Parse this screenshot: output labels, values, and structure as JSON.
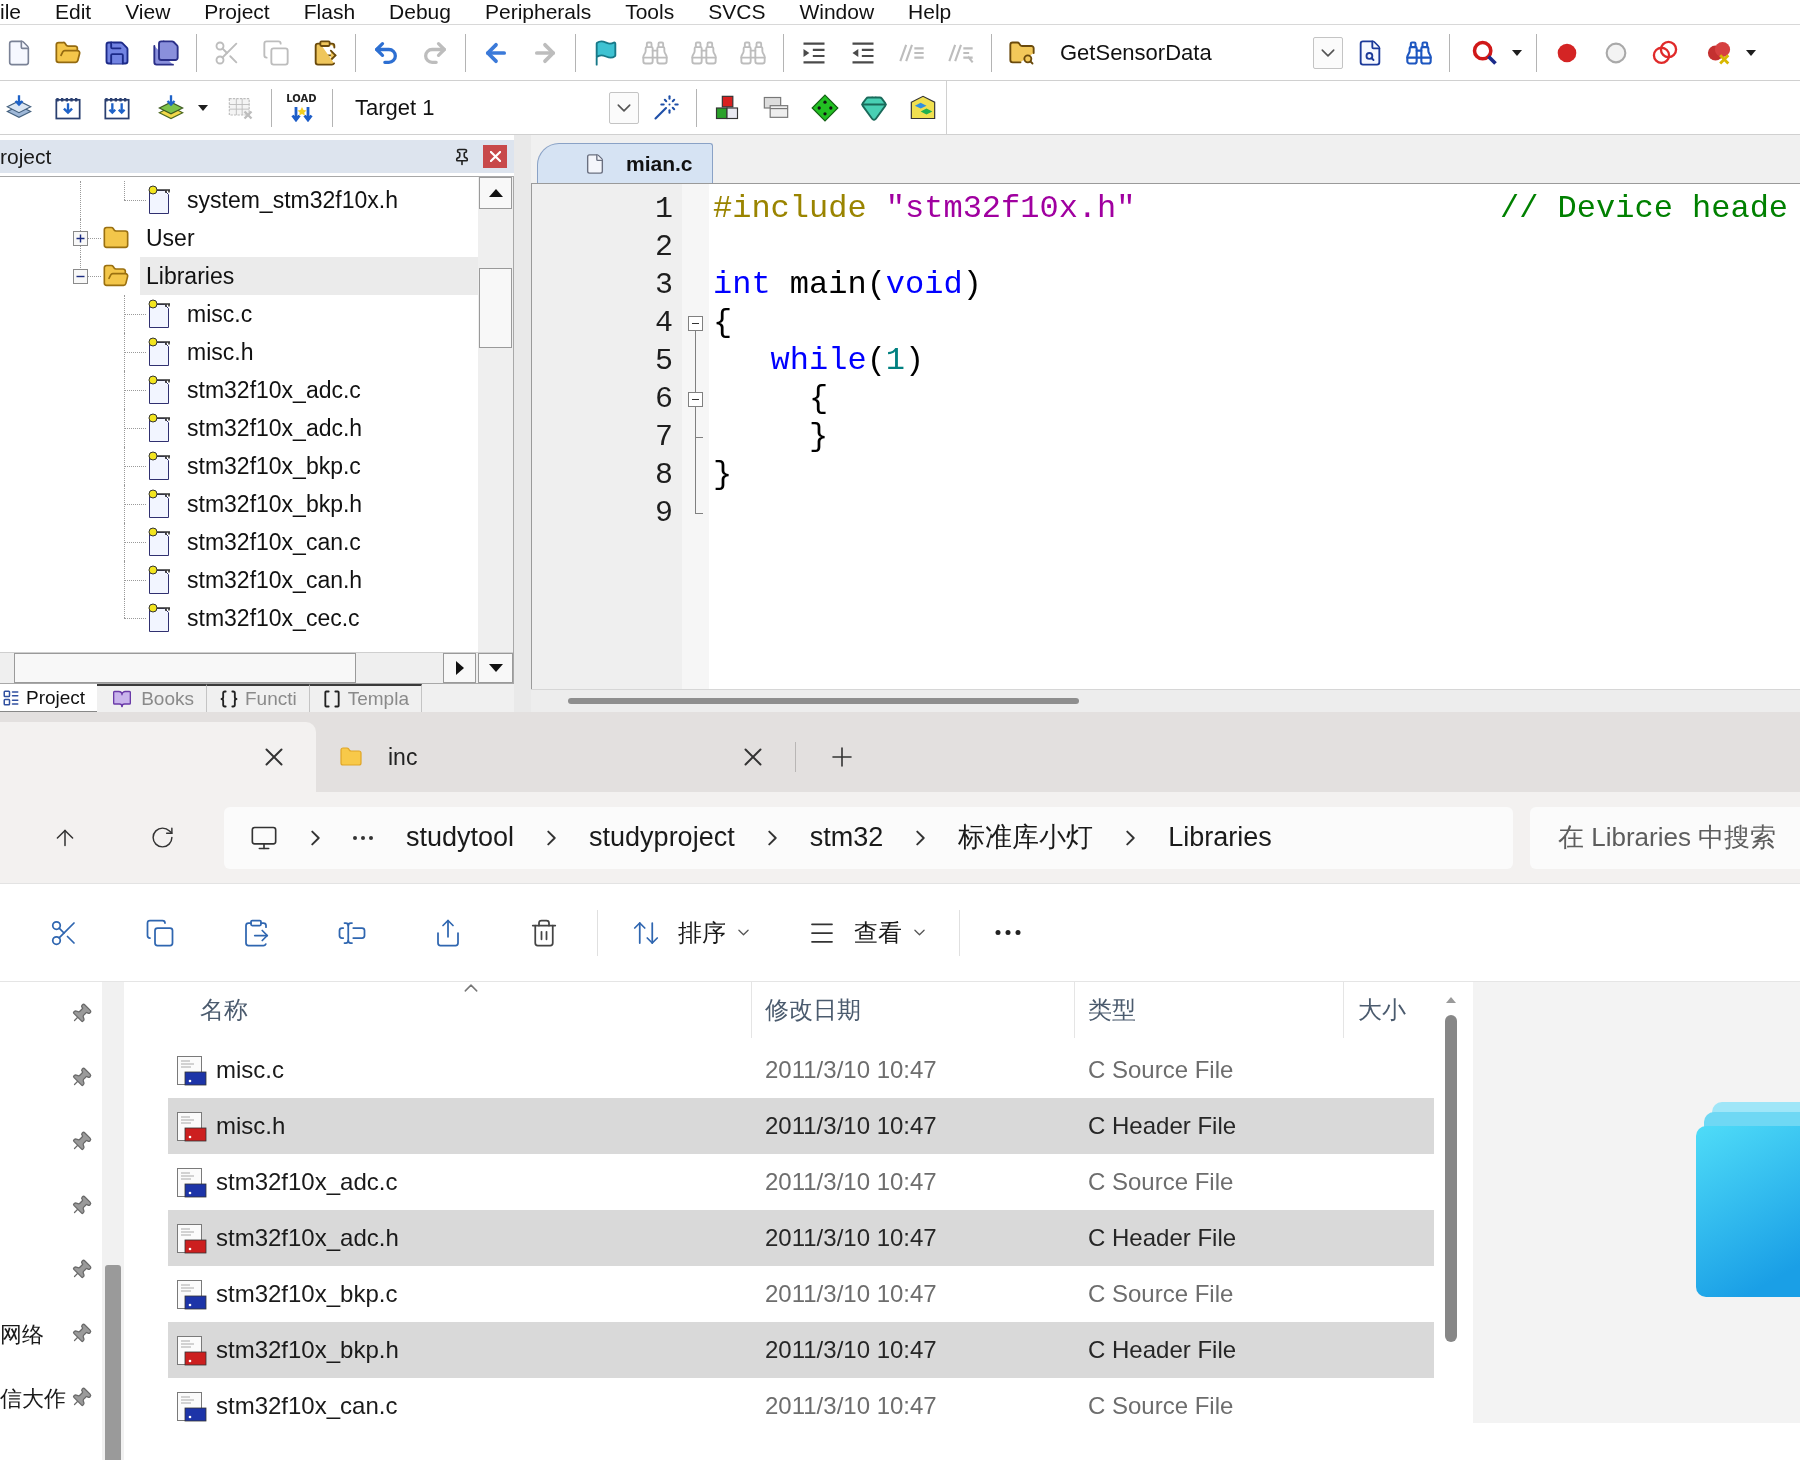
{
  "ide": {
    "menu": [
      "ile",
      "Edit",
      "View",
      "Project",
      "Flash",
      "Debug",
      "Peripherals",
      "Tools",
      "SVCS",
      "Window",
      "Help"
    ],
    "toolbar_1": [
      {
        "kind": "button",
        "disabled": false
      },
      {
        "kind": "button",
        "disabled": false
      },
      {
        "kind": "button",
        "disabled": false
      },
      {
        "kind": "button",
        "disabled": false
      },
      {
        "kind": "separator"
      },
      {
        "kind": "button",
        "disabled": true
      },
      {
        "kind": "button",
        "disabled": true
      },
      {
        "kind": "button",
        "disabled": false
      },
      {
        "kind": "separator"
      },
      {
        "kind": "button",
        "disabled": false
      },
      {
        "kind": "button",
        "disabled": true
      },
      {
        "kind": "separator"
      },
      {
        "kind": "button",
        "disabled": false
      },
      {
        "kind": "button",
        "disabled": true
      },
      {
        "kind": "separator"
      },
      {
        "kind": "button",
        "disabled": false
      },
      {
        "kind": "button",
        "disabled": true
      },
      {
        "kind": "button",
        "disabled": true
      },
      {
        "kind": "button",
        "disabled": true
      },
      {
        "kind": "separator"
      },
      {
        "kind": "button",
        "disabled": false
      },
      {
        "kind": "button",
        "disabled": false
      },
      {
        "kind": "button",
        "disabled": true
      },
      {
        "kind": "button",
        "disabled": true
      },
      {
        "kind": "separator"
      },
      {
        "kind": "button",
        "disabled": false
      },
      {
        "kind": "combo",
        "value": "GetSensorData"
      },
      {
        "kind": "button",
        "disabled": false
      },
      {
        "kind": "button",
        "disabled": false
      },
      {
        "kind": "separator"
      },
      {
        "kind": "dropdown",
        "disabled": false
      },
      {
        "kind": "separator"
      },
      {
        "kind": "button",
        "disabled": false
      },
      {
        "kind": "button",
        "disabled": false
      },
      {
        "kind": "button",
        "disabled": false
      },
      {
        "kind": "dropdown",
        "disabled": false
      }
    ],
    "toolbar_2": [
      {
        "kind": "button",
        "disabled": false
      },
      {
        "kind": "button",
        "disabled": false
      },
      {
        "kind": "button",
        "disabled": false
      },
      {
        "kind": "dropdown",
        "disabled": false
      },
      {
        "kind": "button",
        "disabled": true
      },
      {
        "kind": "separator"
      },
      {
        "kind": "button",
        "label": "LOAD",
        "disabled": false
      },
      {
        "kind": "separator"
      },
      {
        "kind": "combo",
        "value": "Target 1"
      },
      {
        "kind": "button",
        "disabled": false
      },
      {
        "kind": "separator"
      },
      {
        "kind": "button",
        "disabled": false
      },
      {
        "kind": "button",
        "disabled": false
      },
      {
        "kind": "button",
        "disabled": false
      },
      {
        "kind": "button",
        "disabled": false
      },
      {
        "kind": "button",
        "disabled": false
      }
    ],
    "project_panel": {
      "title": "roject",
      "tree": [
        {
          "children": [
            {
              "kind": "file",
              "label": "system_stm32f10x.h",
              "selected": false
            }
          ]
        },
        {
          "kind": "folder",
          "label": "User",
          "expanded": false,
          "selected": false
        },
        {
          "kind": "folder",
          "label": "Libraries",
          "expanded": true,
          "selected": true,
          "children": [
            {
              "kind": "file",
              "label": "misc.c",
              "selected": false
            },
            {
              "kind": "file",
              "label": "misc.h",
              "selected": false
            },
            {
              "kind": "file",
              "label": "stm32f10x_adc.c",
              "selected": false
            },
            {
              "kind": "file",
              "label": "stm32f10x_adc.h",
              "selected": false
            },
            {
              "kind": "file",
              "label": "stm32f10x_bkp.c",
              "selected": false
            },
            {
              "kind": "file",
              "label": "stm32f10x_bkp.h",
              "selected": false
            },
            {
              "kind": "file",
              "label": "stm32f10x_can.c",
              "selected": false
            },
            {
              "kind": "file",
              "label": "stm32f10x_can.h",
              "selected": false
            },
            {
              "kind": "file",
              "label": "stm32f10x_cec.c",
              "selected": false
            }
          ]
        }
      ],
      "tabs": [
        {
          "label": "Project",
          "selected": true
        },
        {
          "label": "Books",
          "selected": false
        },
        {
          "label": "Functi",
          "selected": false
        },
        {
          "label": "Templa",
          "selected": false
        }
      ]
    },
    "editor": {
      "tabs": [
        {
          "label": "mian.c",
          "selected": true
        }
      ],
      "lines": [
        {
          "number": "1",
          "kind": "plain",
          "tokens": [
            {
              "kind": "preprocessor",
              "text": "#include "
            },
            {
              "kind": "string",
              "text": "\"stm32f10x.h\""
            }
          ],
          "comment": "// Device heade"
        },
        {
          "number": "2",
          "kind": "plain"
        },
        {
          "number": "3",
          "kind": "plain",
          "tokens": [
            {
              "kind": "keyword",
              "text": "int"
            },
            {
              "kind": "plain",
              "text": " main("
            },
            {
              "kind": "keyword",
              "text": "void"
            },
            {
              "kind": "plain",
              "text": ")"
            }
          ]
        },
        {
          "number": "4",
          "kind": "fold-open",
          "tokens": [
            {
              "kind": "plain",
              "text": "{"
            }
          ]
        },
        {
          "number": "5",
          "kind": "fold-line",
          "tokens": [
            {
              "kind": "keyword",
              "text": "   while"
            },
            {
              "kind": "plain",
              "text": "("
            },
            {
              "kind": "number",
              "text": "1"
            },
            {
              "kind": "plain",
              "text": ")"
            }
          ]
        },
        {
          "number": "6",
          "kind": "fold-nested-open",
          "tokens": [
            {
              "kind": "plain",
              "text": "     {"
            }
          ]
        },
        {
          "number": "7",
          "kind": "fold-tee",
          "tokens": [
            {
              "kind": "plain",
              "text": "     }"
            }
          ]
        },
        {
          "number": "8",
          "kind": "fold-line",
          "tokens": [
            {
              "kind": "plain",
              "text": "}"
            }
          ]
        },
        {
          "number": "9",
          "kind": "fold-end"
        }
      ]
    }
  },
  "explorer": {
    "tabs": [
      {
        "selected": true
      },
      {
        "label": "inc",
        "selected": false
      }
    ],
    "address": {
      "path": [
        "studytool",
        "studyproject",
        "stm32",
        "标准库小灯",
        "Libraries"
      ]
    },
    "search": {
      "placeholder": "在 Libraries 中搜索"
    },
    "command_bar": {
      "sort": "排序",
      "view": "查看"
    },
    "nav_pane": {
      "items": [
        {
          "pinned": true
        },
        {
          "pinned": true
        },
        {
          "pinned": true
        },
        {
          "pinned": true
        },
        {
          "pinned": true
        },
        {
          "label": "网络",
          "pinned": true
        },
        {
          "label": "信大作",
          "pinned": true
        }
      ]
    },
    "file_list": {
      "columns": [
        {
          "label": "名称",
          "sorted": true
        },
        {
          "label": "修改日期",
          "sorted": false
        },
        {
          "label": "类型",
          "sorted": false
        },
        {
          "label": "大小",
          "sorted": false
        }
      ],
      "rows": [
        {
          "name": "misc.c",
          "kind": "c",
          "date": "2011/3/10 10:47",
          "type": "C Source File",
          "selected": false
        },
        {
          "name": "misc.h",
          "kind": "h",
          "date": "2011/3/10 10:47",
          "type": "C Header File",
          "selected": true
        },
        {
          "name": "stm32f10x_adc.c",
          "kind": "c",
          "date": "2011/3/10 10:47",
          "type": "C Source File",
          "selected": false
        },
        {
          "name": "stm32f10x_adc.h",
          "kind": "h",
          "date": "2011/3/10 10:47",
          "type": "C Header File",
          "selected": true
        },
        {
          "name": "stm32f10x_bkp.c",
          "kind": "c",
          "date": "2011/3/10 10:47",
          "type": "C Source File",
          "selected": false
        },
        {
          "name": "stm32f10x_bkp.h",
          "kind": "h",
          "date": "2011/3/10 10:47",
          "type": "C Header File",
          "selected": true
        },
        {
          "name": "stm32f10x_can.c",
          "kind": "c",
          "date": "2011/3/10 10:47",
          "type": "C Source File",
          "selected": false
        }
      ]
    }
  }
}
